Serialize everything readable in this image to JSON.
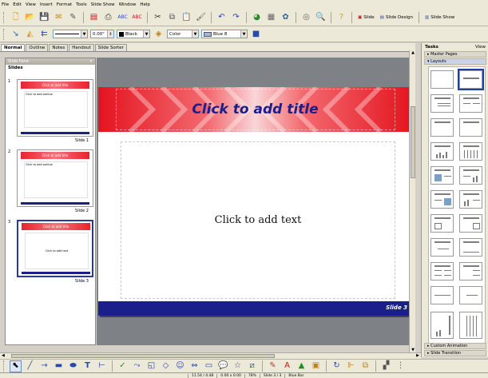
{
  "menu": [
    "File",
    "Edit",
    "View",
    "Insert",
    "Format",
    "Tools",
    "Slide Show",
    "Window",
    "Help"
  ],
  "toolbar1": {
    "slide_label": "Slide",
    "slide_design_label": "Slide Design",
    "slide_show_label": "Slide Show"
  },
  "toolbar2": {
    "line_width": "0.00\"",
    "line_color": "Black",
    "area_style": "Color",
    "area_color": "Blue 8"
  },
  "view_tabs": [
    "Normal",
    "Outline",
    "Notes",
    "Handout",
    "Slide Sorter"
  ],
  "slide_pane": {
    "header": "Slide Pane",
    "label": "Slides",
    "slides": [
      {
        "num": "1",
        "caption": "Slide 1",
        "title": "Click to add title",
        "body": "Click to add outline"
      },
      {
        "num": "2",
        "caption": "Slide 2",
        "title": "Click to add title",
        "body": "Click to add outline"
      },
      {
        "num": "3",
        "caption": "Slide 3",
        "title": "Click to add title",
        "body": "Click to add text"
      }
    ]
  },
  "slide": {
    "title_placeholder": "Click to add title",
    "content_placeholder": "Click to add text",
    "footer_number": "Slide 3"
  },
  "tasks": {
    "title": "Tasks",
    "view_label": "View",
    "master_pages": "Master Pages",
    "layouts": "Layouts",
    "custom_animation": "Custom Animation",
    "slide_transition": "Slide Transition"
  },
  "status": {
    "position": "11.54 / 4.48",
    "size": "0.00 x 0.00",
    "zoom": "78%",
    "slide": "Slide 3 / 3",
    "design": "Blue Bar"
  },
  "colors": {
    "title_red": "#e4141f",
    "title_text": "#1a1f8a",
    "footer_blue": "#1a1f8a"
  }
}
